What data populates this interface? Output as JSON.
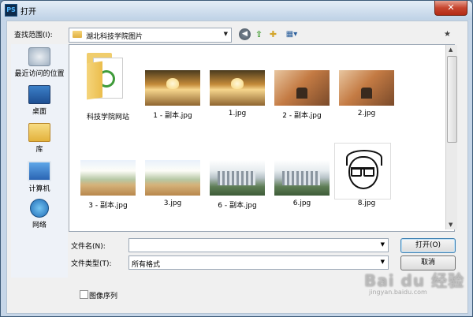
{
  "window": {
    "app_icon": "PS",
    "title": "打开",
    "close_label": "✕"
  },
  "lookin": {
    "label": "查找范围(I):",
    "value": "湖北科技学院图片"
  },
  "toolbar": {
    "back_icon": "back-arrow-icon",
    "up_icon": "up-folder-icon",
    "new_folder_icon": "new-folder-icon",
    "views_icon": "views-menu-icon",
    "favorites_icon": "favorite-star-icon"
  },
  "places": [
    {
      "label": "最近访问的位置",
      "icon": "recent-places-icon"
    },
    {
      "label": "桌面",
      "icon": "desktop-icon"
    },
    {
      "label": "库",
      "icon": "library-icon"
    },
    {
      "label": "计算机",
      "icon": "computer-icon"
    },
    {
      "label": "网络",
      "icon": "network-icon"
    }
  ],
  "files": [
    {
      "name": "科技学院网站",
      "kind": "folder"
    },
    {
      "name": "1 - 副本.jpg",
      "kind": "image-heart"
    },
    {
      "name": "1.jpg",
      "kind": "image-heart"
    },
    {
      "name": "2 - 副本.jpg",
      "kind": "image-deer"
    },
    {
      "name": "2.jpg",
      "kind": "image-deer"
    },
    {
      "name": "3 - 副本.jpg",
      "kind": "image-field"
    },
    {
      "name": "3.jpg",
      "kind": "image-field"
    },
    {
      "name": "6 - 副本.jpg",
      "kind": "image-campus"
    },
    {
      "name": "6.jpg",
      "kind": "image-campus"
    },
    {
      "name": "8.jpg",
      "kind": "image-cartoon"
    }
  ],
  "form": {
    "filename_label": "文件名(N):",
    "filename_value": "",
    "filetype_label": "文件类型(T):",
    "filetype_value": "所有格式"
  },
  "buttons": {
    "open": "打开(O)",
    "cancel": "取消"
  },
  "image_sequence": {
    "label": "图像序列",
    "checked": false
  },
  "watermark": {
    "logo": "Bai du 经验",
    "url": "jingyan.baidu.com"
  },
  "colors": {
    "title_gradient_top": "#e4edf7",
    "close_button": "#c6452f",
    "dialog_bg": "#f0f0f0",
    "list_bg": "#ffffff"
  }
}
